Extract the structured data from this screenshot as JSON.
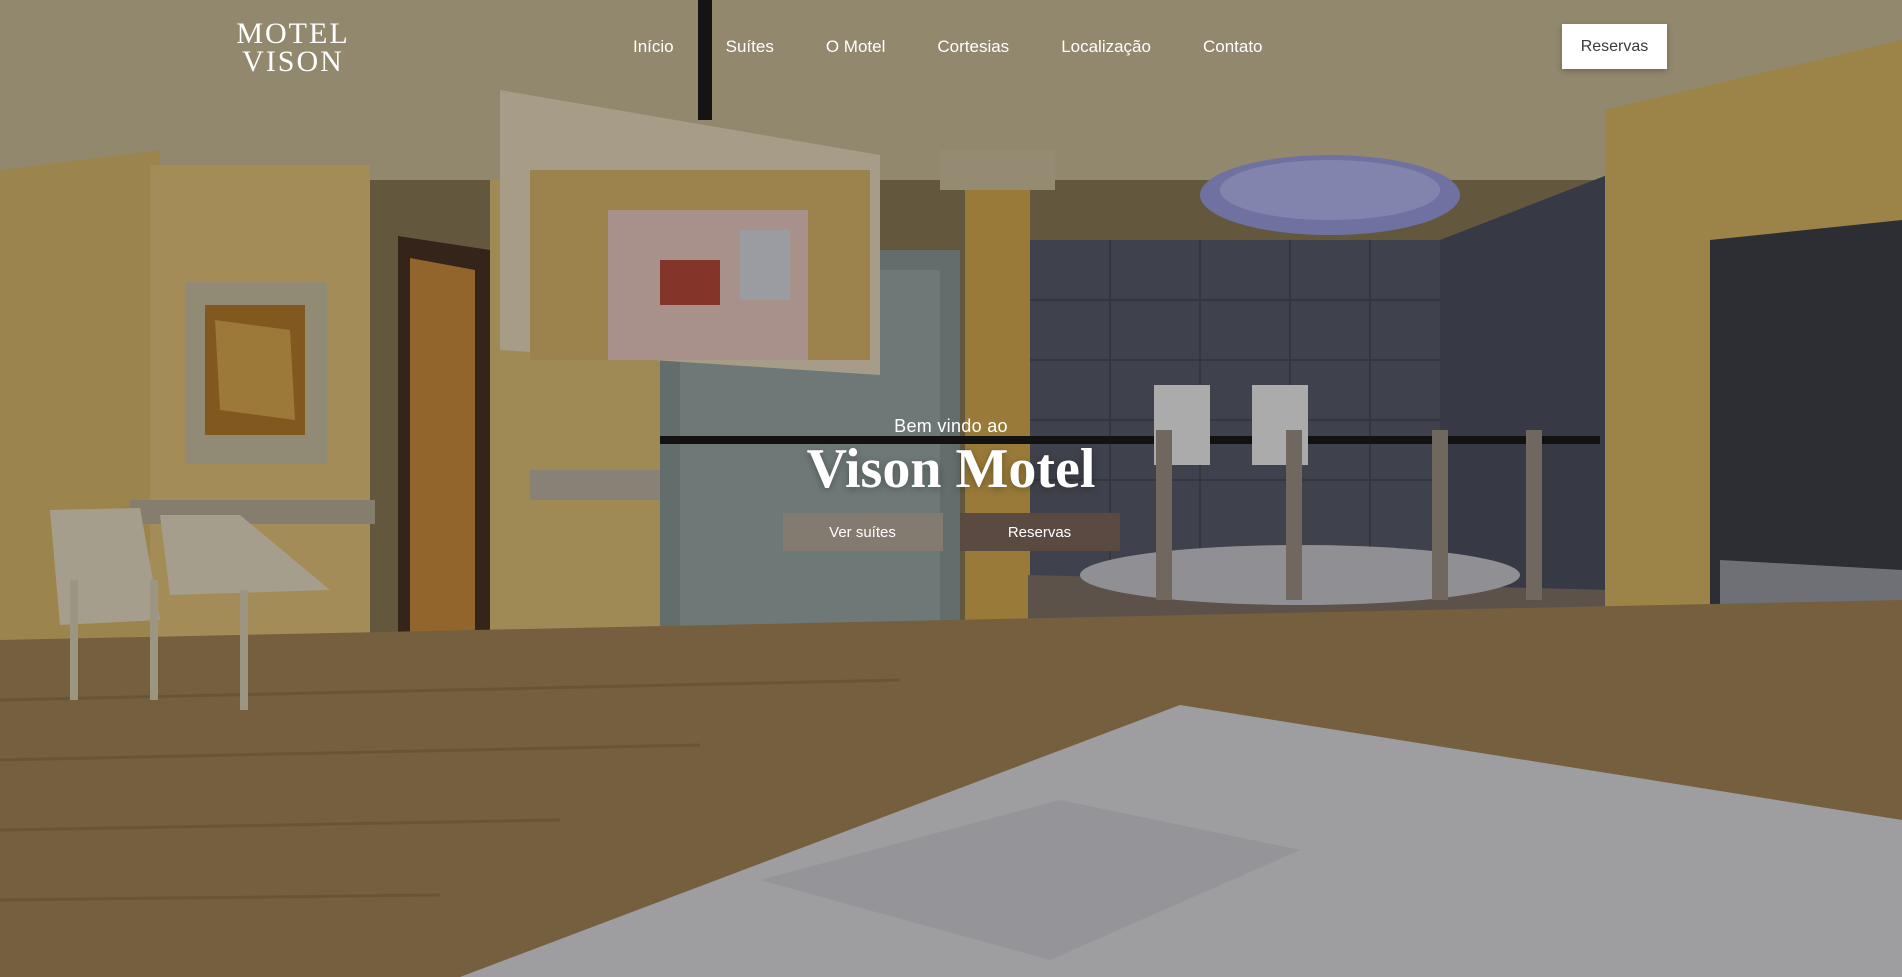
{
  "header": {
    "logo_line1": "MOTEL",
    "logo_line2": "VISON",
    "nav": [
      {
        "label": "Início"
      },
      {
        "label": "Suítes"
      },
      {
        "label": "O Motel"
      },
      {
        "label": "Cortesias"
      },
      {
        "label": "Localização"
      },
      {
        "label": "Contato"
      }
    ],
    "reserve_label": "Reservas"
  },
  "hero": {
    "welcome": "Bem vindo ao",
    "title": "Vison Motel",
    "cta_suites": "Ver suítes",
    "cta_reservas": "Reservas"
  },
  "colors": {
    "btn_suites": "#837a70",
    "btn_reservas": "#5b4a42"
  }
}
